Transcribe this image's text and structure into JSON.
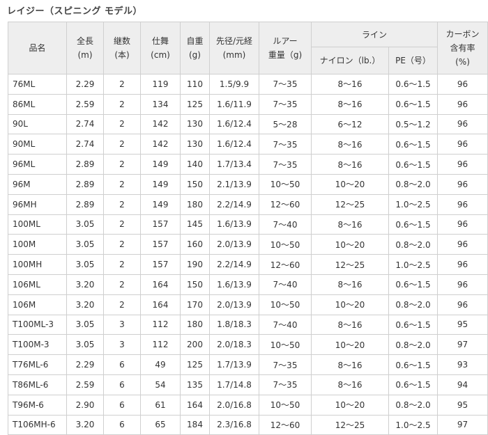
{
  "title": "レイジー（スピニング モデル）",
  "headers": {
    "name": "品名",
    "length": [
      "全長",
      "(m)"
    ],
    "pieces": [
      "継数",
      "(本)"
    ],
    "closed": [
      "仕舞",
      "(cm)"
    ],
    "weight": [
      "自重",
      "(g)"
    ],
    "diameter": [
      "先径/元経",
      "(mm)"
    ],
    "lure": [
      "ルアー",
      "重量（g)"
    ],
    "line": "ライン",
    "nylon": "ナイロン（lb.）",
    "pe": "PE（号）",
    "carbon": [
      "カーボン",
      "含有率",
      "(%)"
    ]
  },
  "rows": [
    [
      "76ML",
      "2.29",
      "2",
      "119",
      "110",
      "1.5/9.9",
      "7〜35",
      "8〜16",
      "0.6〜1.5",
      "96"
    ],
    [
      "86ML",
      "2.59",
      "2",
      "134",
      "125",
      "1.6/11.9",
      "7〜35",
      "8〜16",
      "0.6〜1.5",
      "96"
    ],
    [
      "90L",
      "2.74",
      "2",
      "142",
      "130",
      "1.6/12.4",
      "5〜28",
      "6〜12",
      "0.5〜1.2",
      "96"
    ],
    [
      "90ML",
      "2.74",
      "2",
      "142",
      "130",
      "1.6/12.4",
      "7〜35",
      "8〜16",
      "0.6〜1.5",
      "96"
    ],
    [
      "96ML",
      "2.89",
      "2",
      "149",
      "140",
      "1.7/13.4",
      "7〜35",
      "8〜16",
      "0.6〜1.5",
      "96"
    ],
    [
      "96M",
      "2.89",
      "2",
      "149",
      "150",
      "2.1/13.9",
      "10〜50",
      "10〜20",
      "0.8〜2.0",
      "96"
    ],
    [
      "96MH",
      "2.89",
      "2",
      "149",
      "180",
      "2.2/14.9",
      "12〜60",
      "12〜25",
      "1.0〜2.5",
      "96"
    ],
    [
      "100ML",
      "3.05",
      "2",
      "157",
      "145",
      "1.6/13.9",
      "7〜40",
      "8〜16",
      "0.6〜1.5",
      "96"
    ],
    [
      "100M",
      "3.05",
      "2",
      "157",
      "160",
      "2.0/13.9",
      "10〜50",
      "10〜20",
      "0.8〜2.0",
      "96"
    ],
    [
      "100MH",
      "3.05",
      "2",
      "157",
      "190",
      "2.2/14.9",
      "12〜60",
      "12〜25",
      "1.0〜2.5",
      "96"
    ],
    [
      "106ML",
      "3.20",
      "2",
      "164",
      "150",
      "1.6/13.9",
      "7〜40",
      "8〜16",
      "0.6〜1.5",
      "96"
    ],
    [
      "106M",
      "3.20",
      "2",
      "164",
      "170",
      "2.0/13.9",
      "10〜50",
      "10〜20",
      "0.8〜2.0",
      "96"
    ],
    [
      "T100ML-3",
      "3.05",
      "3",
      "112",
      "180",
      "1.8/18.3",
      "7〜40",
      "8〜16",
      "0.6〜1.5",
      "95"
    ],
    [
      "T100M-3",
      "3.05",
      "3",
      "112",
      "200",
      "2.0/18.3",
      "10〜50",
      "10〜20",
      "0.8〜2.0",
      "97"
    ],
    [
      "T76ML-6",
      "2.29",
      "6",
      "49",
      "125",
      "1.7/13.9",
      "7〜35",
      "8〜16",
      "0.6〜1.5",
      "93"
    ],
    [
      "T86ML-6",
      "2.59",
      "6",
      "54",
      "135",
      "1.7/14.8",
      "7〜35",
      "8〜16",
      "0.6〜1.5",
      "94"
    ],
    [
      "T96M-6",
      "2.90",
      "6",
      "61",
      "164",
      "2.0/16.8",
      "10〜50",
      "10〜20",
      "0.8〜2.0",
      "95"
    ],
    [
      "T106MH-6",
      "3.20",
      "6",
      "65",
      "184",
      "2.3/16.8",
      "12〜60",
      "12〜25",
      "1.0〜2.5",
      "97"
    ]
  ]
}
